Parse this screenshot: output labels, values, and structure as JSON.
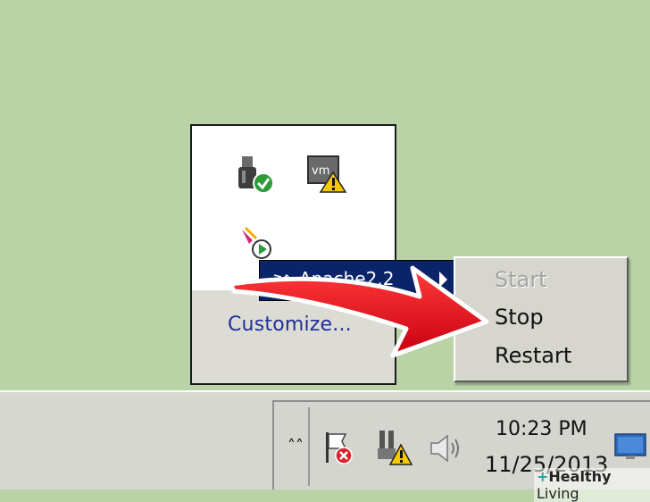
{
  "tray_popup": {
    "customize_label": "Customize...",
    "icons": [
      "usb-safely-remove-icon",
      "vmware-warning-icon",
      "apache-monitor-icon"
    ]
  },
  "apache_item": {
    "label": "Apache2.2"
  },
  "context_menu": {
    "items": [
      {
        "label": "Start",
        "enabled": false
      },
      {
        "label": "Stop",
        "enabled": true
      },
      {
        "label": "Restart",
        "enabled": true
      }
    ]
  },
  "taskbar": {
    "clock_time": "10:23 PM",
    "clock_date": "11/25/2013",
    "icons": [
      "action-center-flag-icon",
      "network-warning-icon",
      "volume-icon",
      "show-desktop-icon"
    ]
  },
  "watermark": {
    "text_bold": "Healthy",
    "text_light": "Living"
  },
  "colors": {
    "desktop": "#b9d2a6",
    "menu_highlight": "#0a246a",
    "arrow_red": "#e01020"
  }
}
